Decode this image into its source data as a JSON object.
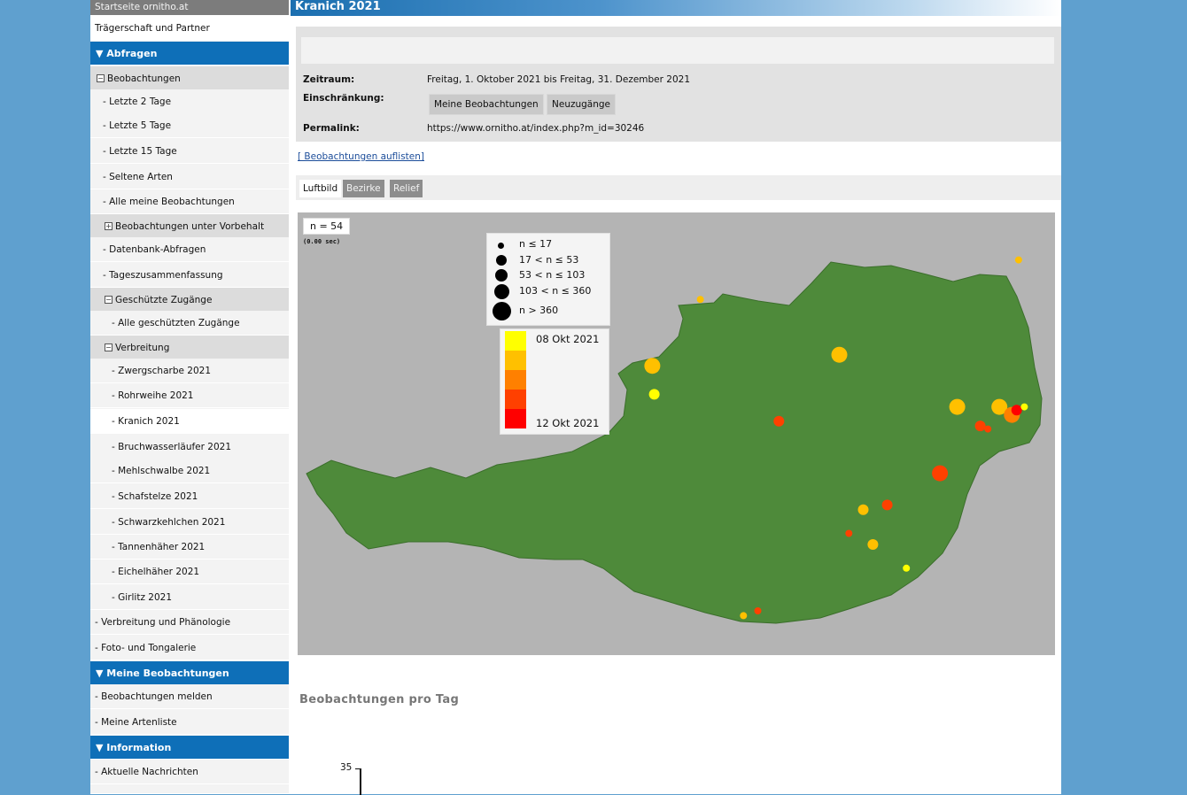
{
  "sidebar": {
    "top_link": "Startseite ornitho.at",
    "partner_link": "Trägerschaft und Partner",
    "header_abfragen": "▼ Abfragen",
    "group_beobachtungen": "Beobachtungen",
    "letzte2": "- Letzte 2 Tage",
    "letzte5": "- Letzte 5 Tage",
    "letzte15": "- Letzte 15 Tage",
    "seltene": "- Seltene Arten",
    "alle_meine": "- Alle meine Beobachtungen",
    "group_vorbehalt": "Beobachtungen unter Vorbehalt",
    "datenbank": "- Datenbank-Abfragen",
    "tageszus": "- Tageszusammenfassung",
    "group_geschuetzt": "Geschützte Zugänge",
    "alle_geschuetzt": "- Alle geschützten Zugänge",
    "group_verbreitung": "Verbreitung",
    "zwergscharbe": "- Zwergscharbe 2021",
    "rohrweihe": "- Rohrweihe 2021",
    "kranich": "- Kranich 2021",
    "bruchwasser": "- Bruchwasserläufer 2021",
    "mehlschwalbe": "- Mehlschwalbe 2021",
    "schafstelze": "- Schafstelze 2021",
    "schwarzkehlchen": "- Schwarzkehlchen 2021",
    "tannenhaeher": "- Tannenhäher 2021",
    "eichelhaeher": "- Eichelhäher 2021",
    "girlitz": "- Girlitz 2021",
    "verbreitung_phaenologie": "- Verbreitung und Phänologie",
    "foto_ton": "- Foto- und Tongalerie",
    "header_meine": "▼ Meine Beobachtungen",
    "melden": "- Beobachtungen melden",
    "artenliste": "- Meine Artenliste",
    "header_information": "▼ Information",
    "nachrichten": "- Aktuelle Nachrichten",
    "toggle_minus": "−",
    "toggle_plus": "+"
  },
  "page": {
    "title": "Kranich 2021",
    "zeitraum_label": "Zeitraum:",
    "zeitraum_value": "Freitag, 1. Oktober 2021 bis Freitag, 31. Dezember 2021",
    "einschraenkung_label": "Einschränkung:",
    "btn_meine": "Meine Beobachtungen",
    "btn_neuzugaenge": "Neuzugänge",
    "permalink_label": "Permalink:",
    "permalink_value": "https://www.ornitho.at/index.php?m_id=30246",
    "list_link": "[ Beobachtungen auflisten]",
    "tab_luftbild": "Luftbild",
    "tab_bezirke": "Bezirke",
    "tab_relief": "Relief",
    "section_title": "Beobachtungen pro Tag",
    "chart_y_tick": "35"
  },
  "map": {
    "count": "n = 54",
    "timing": "(0.00 sec)",
    "size_legend": [
      "n ≤ 17",
      "17 < n ≤ 53",
      "53 < n ≤ 103",
      "103 < n ≤ 360",
      "n > 360"
    ],
    "date_start": "08 Okt 2021",
    "date_end": "12 Okt 2021",
    "colors": [
      "#ffff00",
      "#ffc000",
      "#ff8000",
      "#ff4000",
      "#ff0000"
    ],
    "land_color": "#4e8a3a",
    "points": [
      {
        "lon": 16.92,
        "lat": 48.8,
        "size": 1,
        "color": "#ffc000"
      },
      {
        "lon": 13.6,
        "lat": 48.55,
        "size": 1,
        "color": "#ffc000"
      },
      {
        "lon": 15.05,
        "lat": 48.2,
        "size": 3,
        "color": "#ffc000"
      },
      {
        "lon": 13.1,
        "lat": 48.13,
        "size": 3,
        "color": "#ffc000"
      },
      {
        "lon": 13.12,
        "lat": 47.95,
        "size": 2,
        "color": "#ffff00"
      },
      {
        "lon": 14.42,
        "lat": 47.78,
        "size": 2,
        "color": "#ff4000"
      },
      {
        "lon": 16.28,
        "lat": 47.87,
        "size": 3,
        "color": "#ffc000"
      },
      {
        "lon": 16.72,
        "lat": 47.87,
        "size": 3,
        "color": "#ffc000"
      },
      {
        "lon": 16.85,
        "lat": 47.82,
        "size": 3,
        "color": "#ff8000"
      },
      {
        "lon": 16.9,
        "lat": 47.85,
        "size": 2,
        "color": "#ff0000"
      },
      {
        "lon": 16.98,
        "lat": 47.87,
        "size": 1,
        "color": "#ffff00"
      },
      {
        "lon": 16.52,
        "lat": 47.75,
        "size": 2,
        "color": "#ff4000"
      },
      {
        "lon": 16.6,
        "lat": 47.73,
        "size": 1,
        "color": "#ff4000"
      },
      {
        "lon": 16.1,
        "lat": 47.45,
        "size": 3,
        "color": "#ff4000"
      },
      {
        "lon": 15.55,
        "lat": 47.25,
        "size": 2,
        "color": "#ff4000"
      },
      {
        "lon": 15.3,
        "lat": 47.22,
        "size": 2,
        "color": "#ffc000"
      },
      {
        "lon": 15.15,
        "lat": 47.07,
        "size": 1,
        "color": "#ff4000"
      },
      {
        "lon": 15.4,
        "lat": 47.0,
        "size": 2,
        "color": "#ffc000"
      },
      {
        "lon": 15.75,
        "lat": 46.85,
        "size": 1,
        "color": "#ffff00"
      },
      {
        "lon": 14.2,
        "lat": 46.58,
        "size": 1,
        "color": "#ff4000"
      },
      {
        "lon": 14.05,
        "lat": 46.55,
        "size": 1,
        "color": "#ffc000"
      }
    ]
  }
}
